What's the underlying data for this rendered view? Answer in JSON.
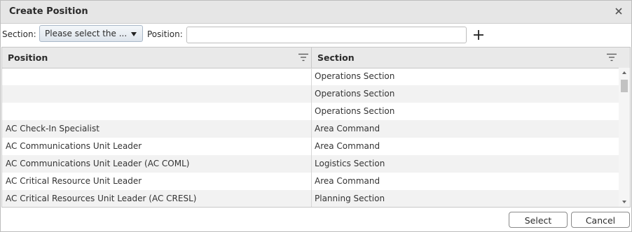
{
  "dialog": {
    "title": "Create Position",
    "close_icon": "close-icon"
  },
  "toolbar": {
    "section_label": "Section:",
    "section_select_value": "Please select the ...",
    "position_label": "Position:",
    "position_value": "",
    "add_icon": "plus-icon"
  },
  "grid": {
    "columns": [
      "Position",
      "Section"
    ],
    "rows": [
      {
        "position": "",
        "section": "Operations Section"
      },
      {
        "position": "",
        "section": "Operations Section"
      },
      {
        "position": "",
        "section": "Operations Section"
      },
      {
        "position": "AC Check-In Specialist",
        "section": "Area Command"
      },
      {
        "position": "AC Communications Unit Leader",
        "section": "Area Command"
      },
      {
        "position": "AC Communications Unit Leader (AC COML)",
        "section": "Logistics Section"
      },
      {
        "position": "AC Critical Resource Unit Leader",
        "section": "Area Command"
      },
      {
        "position": "AC Critical Resources Unit Leader (AC CRESL)",
        "section": "Planning Section"
      }
    ]
  },
  "footer": {
    "select_label": "Select",
    "cancel_label": "Cancel"
  }
}
